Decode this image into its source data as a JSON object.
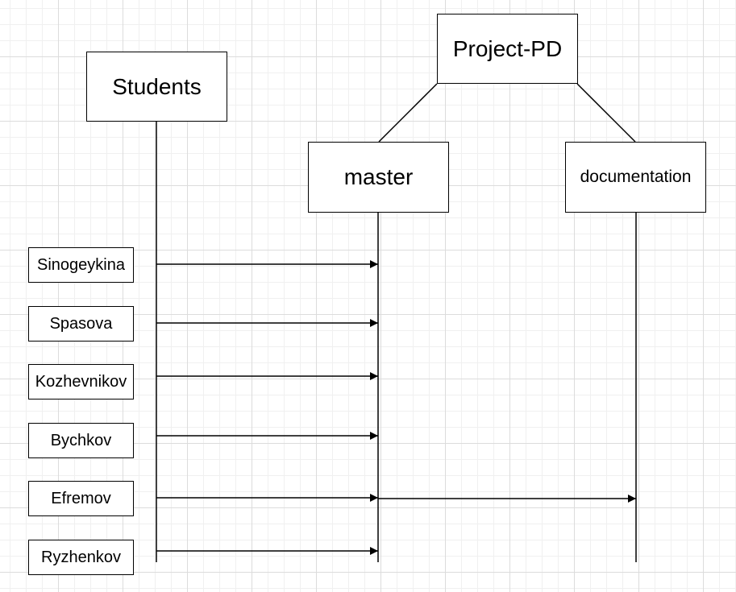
{
  "diagram": {
    "repository": "Project-PD",
    "branches": [
      {
        "id": "master",
        "label": "master"
      },
      {
        "id": "documentation",
        "label": "documentation"
      }
    ],
    "actor_group": "Students",
    "students": [
      {
        "name": "Sinogeykina",
        "targets": [
          "master"
        ]
      },
      {
        "name": "Spasova",
        "targets": [
          "master"
        ]
      },
      {
        "name": "Kozhevnikov",
        "targets": [
          "master"
        ]
      },
      {
        "name": "Bychkov",
        "targets": [
          "master"
        ]
      },
      {
        "name": "Efremov",
        "targets": [
          "master",
          "documentation"
        ]
      },
      {
        "name": "Ryzhenkov",
        "targets": [
          "master"
        ]
      }
    ]
  }
}
